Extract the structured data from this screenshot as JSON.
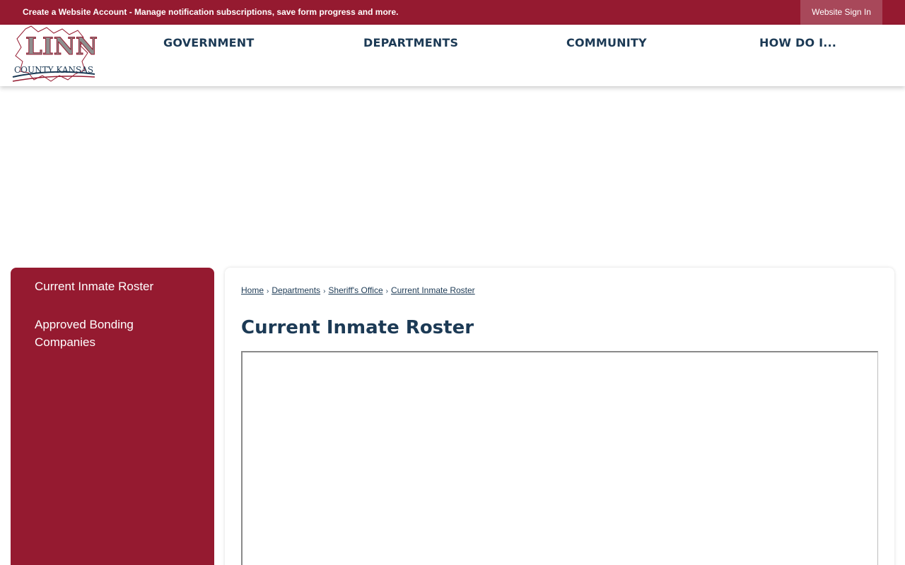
{
  "topbar": {
    "account_link": "Create a Website Account",
    "message": " - Manage notification subscriptions, save form progress and more.",
    "signin_label": "Website Sign In"
  },
  "logo": {
    "line1": "LINN",
    "line2": "COUNTY KANSAS"
  },
  "nav": {
    "items": [
      "GOVERNMENT",
      "DEPARTMENTS",
      "COMMUNITY",
      "HOW DO I..."
    ]
  },
  "sidebar": {
    "items": [
      "Current Inmate Roster",
      "Approved Bonding Companies"
    ]
  },
  "breadcrumb": {
    "items": [
      "Home",
      "Departments",
      "Sheriff's Office",
      "Current Inmate Roster"
    ],
    "separator": "›"
  },
  "page": {
    "title": "Current Inmate Roster"
  },
  "colors": {
    "brand_red": "#951a30",
    "navy": "#1c3a55"
  }
}
